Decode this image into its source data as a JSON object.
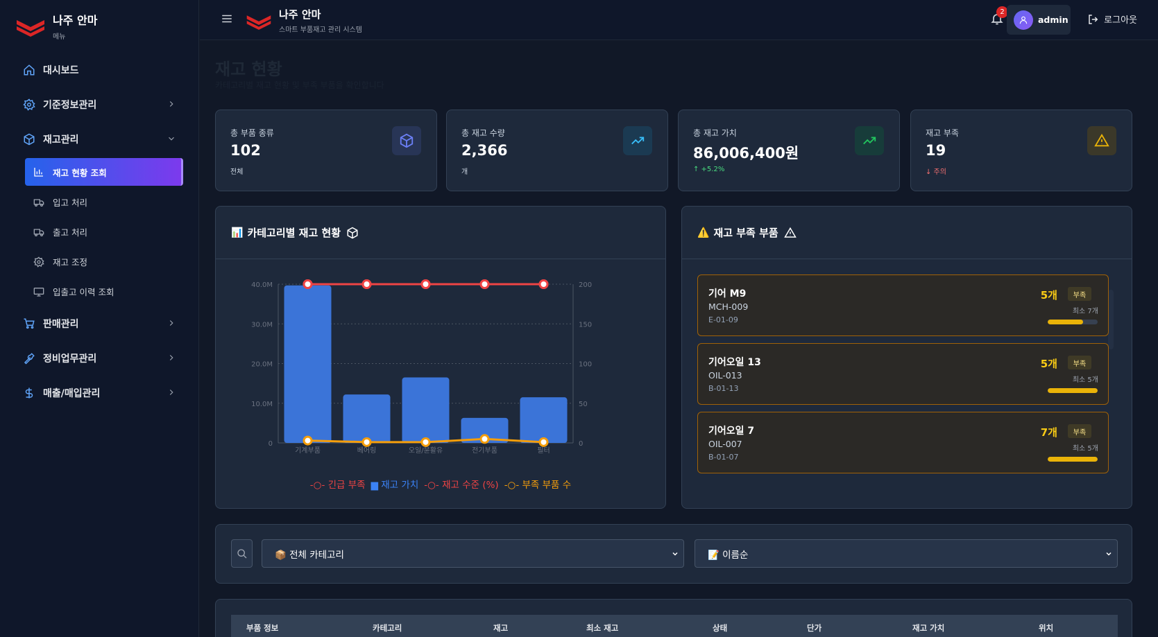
{
  "sidebar": {
    "brand_title": "나주 안마",
    "brand_sub": "메뉴",
    "items": [
      {
        "label": "대시보드"
      },
      {
        "label": "기준정보관리"
      },
      {
        "label": "재고관리"
      },
      {
        "label": "판매관리"
      },
      {
        "label": "정비업무관리"
      },
      {
        "label": "매출/매입관리"
      }
    ],
    "sub_items": [
      {
        "label": "재고 현황 조회"
      },
      {
        "label": "입고 처리"
      },
      {
        "label": "출고 처리"
      },
      {
        "label": "재고 조정"
      },
      {
        "label": "입출고 이력 조회"
      }
    ]
  },
  "header": {
    "title": "나주 안마",
    "subtitle": "스마트 부품재고 관리 시스템",
    "notification_count": "2",
    "user_name": "admin",
    "logout_label": "로그아웃"
  },
  "page": {
    "title": "재고 현황",
    "subtitle": "카테고리별 재고 현황 및 부족 부품을 확인합니다"
  },
  "stats": [
    {
      "label": "총 부품 종류",
      "value": "102",
      "note": "전체"
    },
    {
      "label": "총 재고 수량",
      "value": "2,366",
      "note": "개"
    },
    {
      "label": "총 재고 가치",
      "value": "86,006,400원",
      "note": "↑ +5.2%"
    },
    {
      "label": "재고 부족",
      "value": "19",
      "note": "↓ 주의"
    }
  ],
  "chart_panel": {
    "emoji": "📊",
    "title": "카테고리별 재고 현황"
  },
  "chart_data": {
    "type": "bar",
    "categories": [
      "기계부품",
      "베어링",
      "오일/윤활유",
      "전기부품",
      "필터"
    ],
    "series": [
      {
        "name": "재고 가치",
        "type": "bar",
        "axis": "left",
        "values": [
          39700000,
          12200000,
          16500000,
          6300000,
          11500000
        ],
        "color": "#3b74d8"
      },
      {
        "name": "긴급 부족",
        "type": "line",
        "axis": "right",
        "values": [
          200,
          200,
          200,
          200,
          200
        ],
        "color": "#ef4444"
      },
      {
        "name": "재고 수준 (%)",
        "type": "line",
        "axis": "right",
        "values": [
          200,
          200,
          200,
          200,
          200
        ],
        "color": "#ef4444"
      },
      {
        "name": "부족 부품 수",
        "type": "line",
        "axis": "right",
        "values": [
          3,
          1,
          1,
          5,
          1
        ],
        "color": "#f59e0b"
      }
    ],
    "ylim_left": [
      0,
      40000000
    ],
    "yticks_left": [
      "0",
      "10.0M",
      "20.0M",
      "30.0M",
      "40.0M"
    ],
    "ylim_right": [
      0,
      200
    ],
    "yticks_right": [
      "0",
      "50",
      "100",
      "150",
      "200"
    ],
    "legend": [
      {
        "name": "긴급 부족",
        "color": "#ef4444",
        "marker": "line"
      },
      {
        "name": "재고 가치",
        "color": "#3b82f6",
        "marker": "box"
      },
      {
        "name": "재고 수준 (%)",
        "color": "#ef4444",
        "marker": "line"
      },
      {
        "name": "부족 부품 수",
        "color": "#f59e0b",
        "marker": "line"
      }
    ],
    "legend_position": "bottom",
    "grid": true
  },
  "low_stock_panel": {
    "emoji": "⚠️",
    "title": "재고 부족 부품"
  },
  "low_stock": [
    {
      "name": "기어 M9",
      "code": "MCH-009",
      "location": "E-01-09",
      "qty": "5개",
      "badge": "부족",
      "min": "최소 7개",
      "ratio": 0.71
    },
    {
      "name": "기어오일 13",
      "code": "OIL-013",
      "location": "B-01-13",
      "qty": "5개",
      "badge": "부족",
      "min": "최소 5개",
      "ratio": 1.0
    },
    {
      "name": "기어오일 7",
      "code": "OIL-007",
      "location": "B-01-07",
      "qty": "7개",
      "badge": "부족",
      "min": "최소 5개",
      "ratio": 1.0
    }
  ],
  "filters": {
    "category_selected": "📦 전체 카테고리",
    "sort_selected": "📝 이름순"
  },
  "table": {
    "headers": [
      "부품 정보",
      "카테고리",
      "재고",
      "최소 재고",
      "상태",
      "단가",
      "재고 가치",
      "위치"
    ]
  },
  "colors": {
    "accent_gradient_start": "#2563eb",
    "accent_gradient_end": "#7c3aed",
    "warning": "#eab308"
  }
}
